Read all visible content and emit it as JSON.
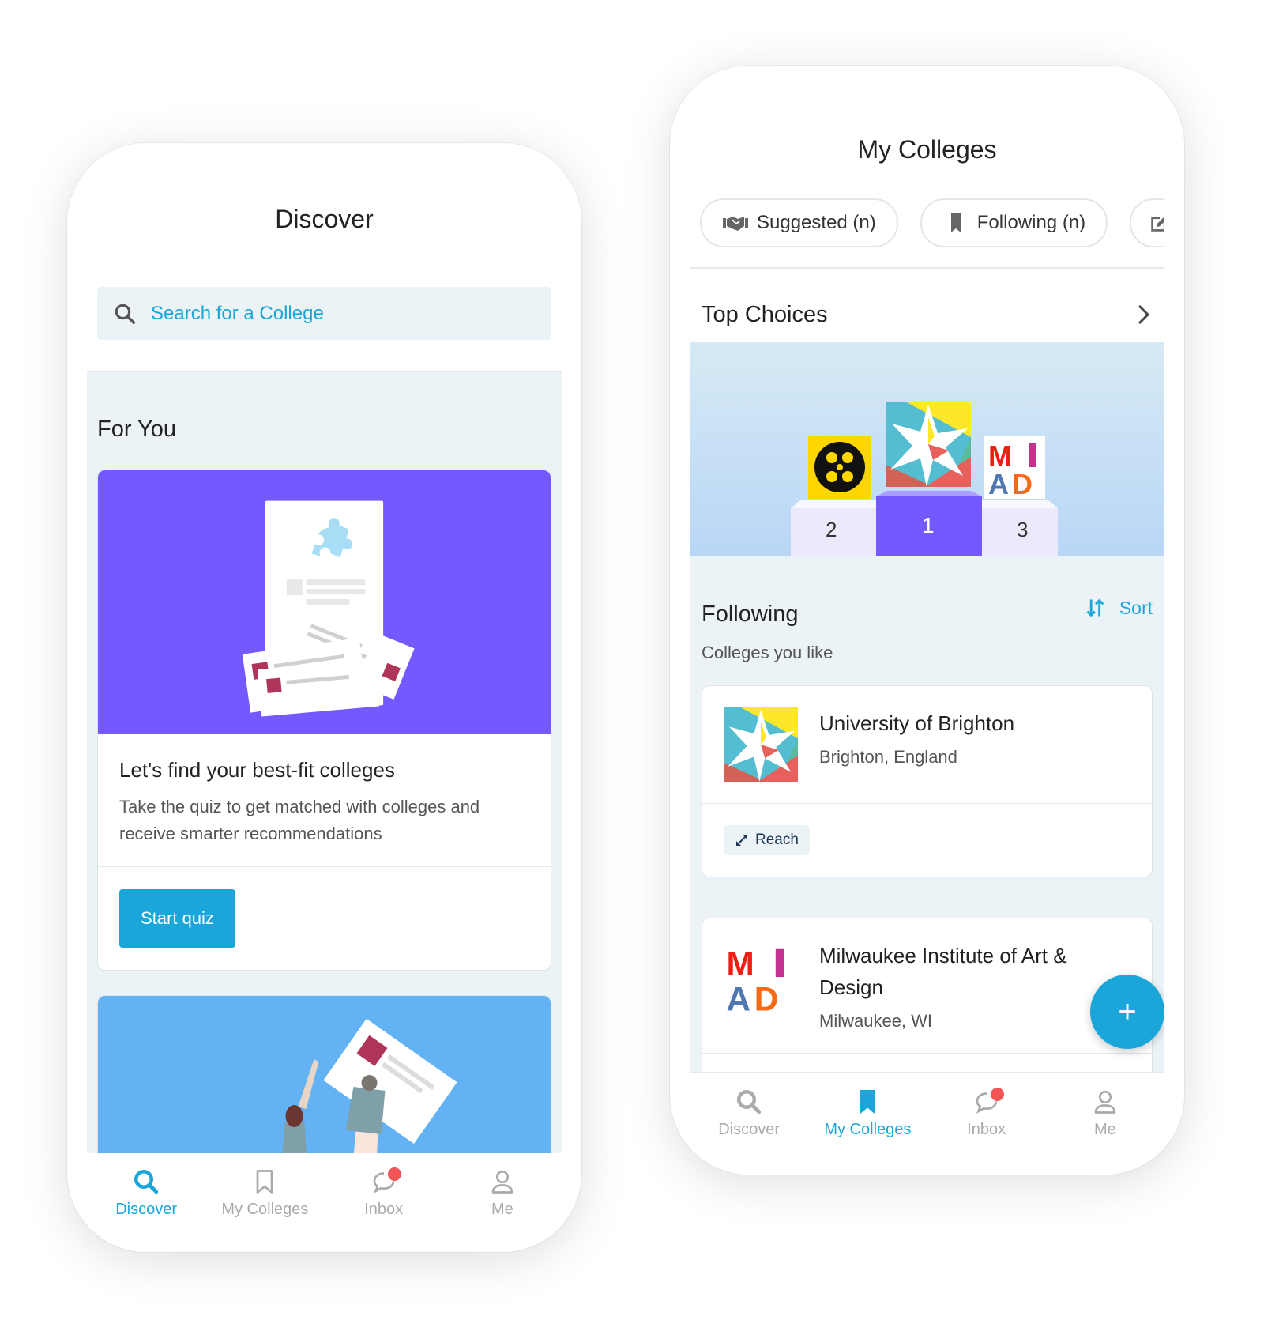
{
  "left_screen": {
    "title": "Discover",
    "search": {
      "placeholder": "Search for a College",
      "icon": "search-icon"
    },
    "section_title": "For You",
    "quiz_card": {
      "heading": "Let's find your best-fit colleges",
      "body": "Take the quiz to get matched with colleges and receive smarter recommendations",
      "button": "Start quiz"
    },
    "tabbar": [
      {
        "label": "Discover",
        "icon": "search-icon",
        "active": true
      },
      {
        "label": "My Colleges",
        "icon": "bookmark-icon",
        "active": false
      },
      {
        "label": "Inbox",
        "icon": "chat-bubble-icon",
        "active": false,
        "badge": true
      },
      {
        "label": "Me",
        "icon": "person-icon",
        "active": false
      }
    ]
  },
  "right_screen": {
    "title": "My Colleges",
    "chips": [
      {
        "label": "Suggested (n)",
        "icon": "handshake-icon"
      },
      {
        "label": "Following (n)",
        "icon": "bookmark-icon"
      },
      {
        "label": "",
        "icon": "edit-icon"
      }
    ],
    "top_choices": {
      "label": "Top Choices",
      "ranks": [
        "2",
        "1",
        "3"
      ]
    },
    "following": {
      "title": "Following",
      "subtitle": "Colleges you like",
      "sort_label": "Sort",
      "colleges": [
        {
          "name": "University of Brighton",
          "location": "Brighton, England",
          "tag": "Reach"
        },
        {
          "name": "Milwaukee Institute of Art & Design",
          "location": "Milwaukee, WI",
          "tag": ""
        }
      ]
    },
    "fab_label": "+",
    "tabbar": [
      {
        "label": "Discover",
        "icon": "search-icon",
        "active": false
      },
      {
        "label": "My Colleges",
        "icon": "bookmark-icon",
        "active": true
      },
      {
        "label": "Inbox",
        "icon": "chat-bubble-icon",
        "active": false,
        "badge": true
      },
      {
        "label": "Me",
        "icon": "person-icon",
        "active": false
      }
    ]
  },
  "colors": {
    "accent": "#1ba6da",
    "purple": "#7359ff",
    "sky": "#63b3f4",
    "feed_bg": "#ecf3f7",
    "badge": "#f25555"
  }
}
